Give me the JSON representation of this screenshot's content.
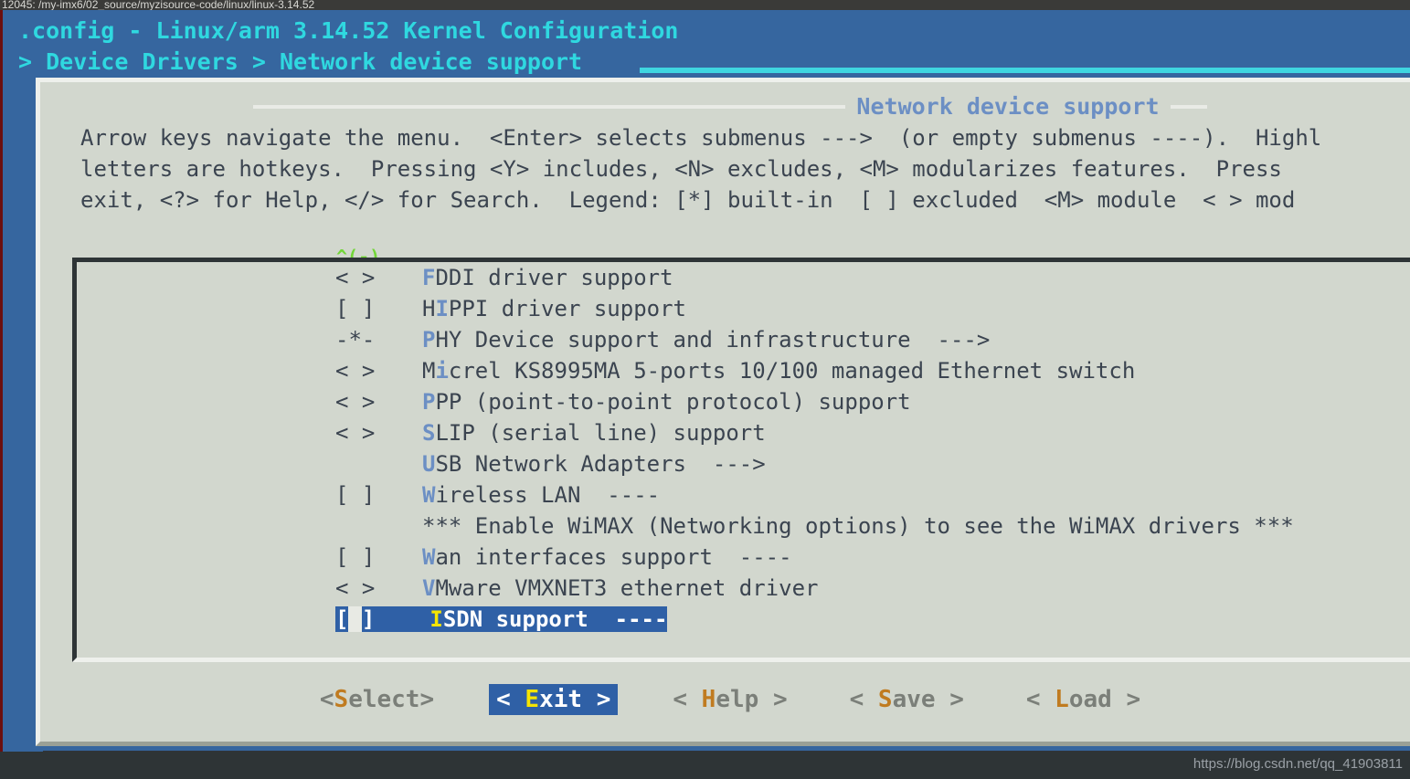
{
  "terminal": {
    "tab_title": "12045: /my-imx6/02_source/myzisource-code/linux/linux-3.14.52"
  },
  "header": {
    "title": ".config - Linux/arm 3.14.52 Kernel Configuration",
    "breadcrumb": "> Device Drivers > Network device support"
  },
  "dialog": {
    "caption": "Network device support",
    "help_line1": "Arrow keys navigate the menu.  <Enter> selects submenus --->  (or empty submenus ----).  Highl",
    "help_line2": "letters are hotkeys.  Pressing <Y> includes, <N> excludes, <M> modularizes features.  Press",
    "help_line3": "exit, <?> for Help, </> for Search.  Legend: [*] built-in  [ ] excluded  <M> module  < > mod",
    "scroll_indicator": "^(-)"
  },
  "list": {
    "items": [
      {
        "marker": "< >",
        "pre": "",
        "hot": "F",
        "post": "DDI driver support",
        "selected": false
      },
      {
        "marker": "[ ]",
        "pre": "H",
        "hot": "I",
        "post": "PPI driver support",
        "selected": false
      },
      {
        "marker": "-*-",
        "pre": "",
        "hot": "P",
        "post": "HY Device support and infrastructure  --->",
        "selected": false
      },
      {
        "marker": "< >",
        "pre": "M",
        "hot": "i",
        "post": "crel KS8995MA 5-ports 10/100 managed Ethernet switch",
        "selected": false
      },
      {
        "marker": "< >",
        "pre": "",
        "hot": "P",
        "post": "PP (point-to-point protocol) support",
        "selected": false
      },
      {
        "marker": "< >",
        "pre": "",
        "hot": "S",
        "post": "LIP (serial line) support",
        "selected": false
      },
      {
        "marker": "",
        "pre": "",
        "hot": "U",
        "post": "SB Network Adapters  --->",
        "selected": false
      },
      {
        "marker": "[ ]",
        "pre": "",
        "hot": "W",
        "post": "ireless LAN  ----",
        "selected": false
      },
      {
        "marker": "",
        "pre": "",
        "hot": "",
        "post": "*** Enable WiMAX (Networking options) to see the WiMAX drivers ***",
        "selected": false
      },
      {
        "marker": "[ ]",
        "pre": "",
        "hot": "W",
        "post": "an interfaces support  ----",
        "selected": false
      },
      {
        "marker": "< >",
        "pre": "",
        "hot": "V",
        "post": "Mware VMXNET3 ethernet driver",
        "selected": false
      },
      {
        "marker": "[ ]",
        "pre": "",
        "hot": "I",
        "post": "SDN support  ----",
        "selected": true
      }
    ]
  },
  "buttons": [
    {
      "name": "select",
      "pre": "<",
      "hot": "S",
      "post": "elect>",
      "active": false
    },
    {
      "name": "exit",
      "pre": "< ",
      "hot": "E",
      "post": "xit >",
      "active": true
    },
    {
      "name": "help",
      "pre": "< ",
      "hot": "H",
      "post": "elp >",
      "active": false
    },
    {
      "name": "save",
      "pre": "< ",
      "hot": "S",
      "post": "ave >",
      "active": false
    },
    {
      "name": "load",
      "pre": "< ",
      "hot": "L",
      "post": "oad >",
      "active": false
    }
  ],
  "watermark": {
    "text": "https://blog.csdn.net/qq_41903811"
  }
}
